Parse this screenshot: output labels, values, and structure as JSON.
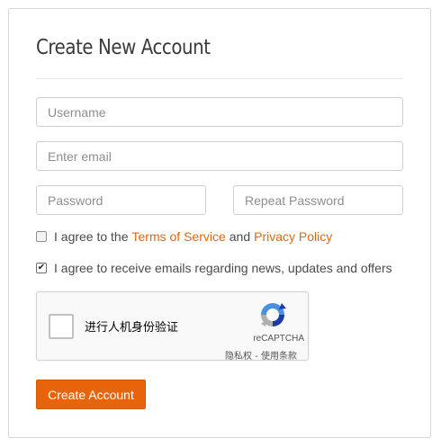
{
  "form": {
    "title": "Create New Account",
    "username": {
      "placeholder": "Username",
      "value": ""
    },
    "email": {
      "placeholder": "Enter email",
      "value": ""
    },
    "password": {
      "placeholder": "Password",
      "value": ""
    },
    "repeat_password": {
      "placeholder": "Repeat Password",
      "value": ""
    },
    "terms": {
      "checked": false,
      "prefix": "I agree to the",
      "terms_link": "Terms of Service",
      "middle": "and",
      "privacy_link": "Privacy Policy"
    },
    "newsletter": {
      "checked": true,
      "check_glyph": "✔",
      "label": "I agree to receive emails regarding news, updates and offers"
    },
    "captcha": {
      "label": "进行人机身份验证",
      "brand": "reCAPTCHA",
      "privacy": "隐私权",
      "separator": " - ",
      "terms": "使用条款",
      "logo_icon": "recaptcha-logo-icon"
    },
    "submit_label": "Create Account"
  },
  "colors": {
    "accent": "#e8640b",
    "border": "#cfcfcf",
    "title": "#3a3a3a"
  }
}
